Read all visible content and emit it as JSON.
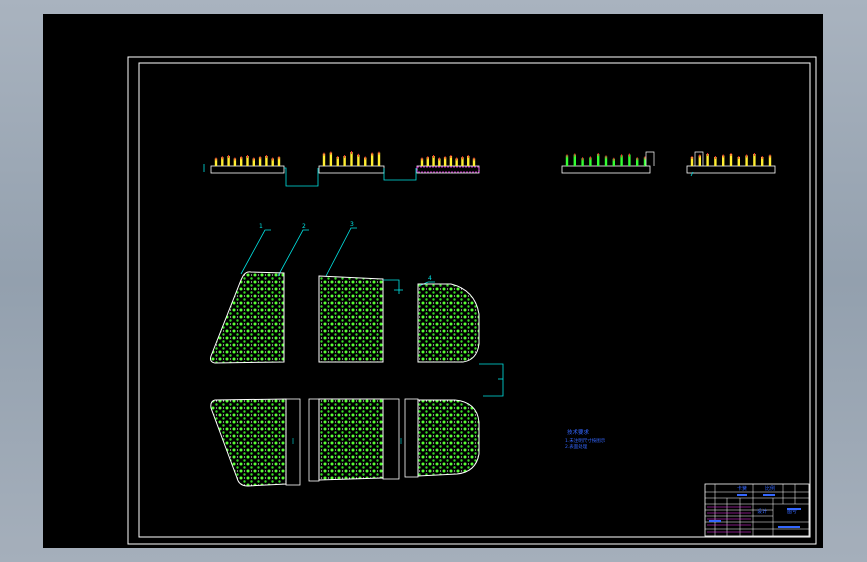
{
  "viewer": {
    "background": "#000000",
    "frame_color": "#ffffff"
  },
  "callouts": [
    "1",
    "2",
    "3",
    "4"
  ],
  "notes": {
    "heading": "技术要求",
    "lines": [
      "1.未注明尺寸按图示",
      "2.表面处理"
    ]
  },
  "title_block": {
    "label_a": "卡簧",
    "label_b": "比例",
    "label_c": "图号",
    "label_d": "设计"
  },
  "colors": {
    "outline": "#ffffff",
    "dimension": "#00e5e5",
    "holes": "#55ff33",
    "pins_yellow": "#ffee33",
    "pins_red": "#ff3333",
    "pins_green": "#33ff33",
    "magenta": "#ff33ff",
    "blue_text": "#3366ff"
  }
}
